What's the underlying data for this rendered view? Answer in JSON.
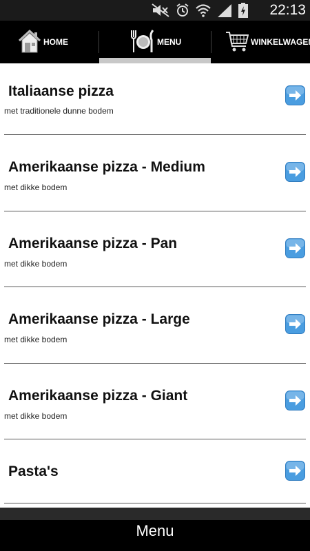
{
  "status_bar": {
    "time": "22:13",
    "icons": [
      "mute-icon",
      "alarm-icon",
      "wifi-icon",
      "signal-icon",
      "battery-charging-icon"
    ]
  },
  "nav": {
    "home_label": "HOME",
    "menu_label": "MENU",
    "cart_label": "WINKELWAGEN",
    "active_tab": "MENU"
  },
  "menu_items": [
    {
      "title": "Italiaanse pizza",
      "subtitle": "met traditionele dunne bodem"
    },
    {
      "title": "Amerikaanse pizza - Medium",
      "subtitle": "met dikke bodem"
    },
    {
      "title": "Amerikaanse pizza - Pan",
      "subtitle": "met dikke bodem"
    },
    {
      "title": "Amerikaanse pizza - Large",
      "subtitle": "met dikke bodem"
    },
    {
      "title": "Amerikaanse pizza - Giant",
      "subtitle": "met dikke bodem"
    },
    {
      "title": "Pasta's",
      "subtitle": ""
    }
  ],
  "bottom_bar": {
    "title": "Menu"
  },
  "colors": {
    "arrow_blue": "#4a9de0",
    "nav_bg": "#000000",
    "indicator": "#c8c8c8"
  }
}
